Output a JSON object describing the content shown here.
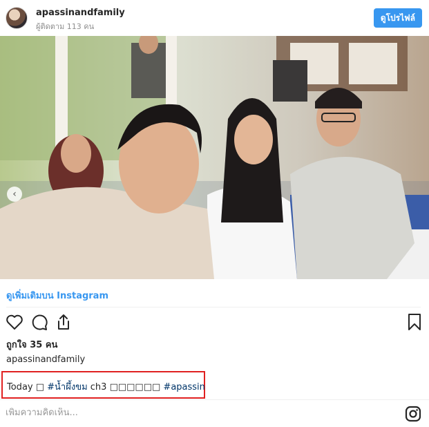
{
  "header": {
    "username": "apassinandfamily",
    "followers": "ผู้ติดตาม 113 คน",
    "profile_button": "ดูโปรไฟล์"
  },
  "post": {
    "image_icon": "photo",
    "carousel": {
      "current": 2,
      "total": 2
    },
    "more_on_instagram": "ดูเพิ่มเติมบน Instagram",
    "likes": "ถูกใจ 35 คน",
    "caption_user": "apassinandfamily",
    "caption": {
      "prefix": "Today □ ",
      "hashtag1": "#น้ำผึ้งขม",
      "middle": " ch3 □□□□□□ ",
      "hashtag2": "#apassin"
    },
    "comment_placeholder": "เพิ่มความคิดเห็น..."
  },
  "colors": {
    "accent": "#3897f0",
    "highlight_border": "#e02020",
    "hashtag": "#003569"
  },
  "icons": [
    "heart-icon",
    "comment-icon",
    "share-icon",
    "bookmark-icon",
    "instagram-icon",
    "chevron-left-icon"
  ]
}
